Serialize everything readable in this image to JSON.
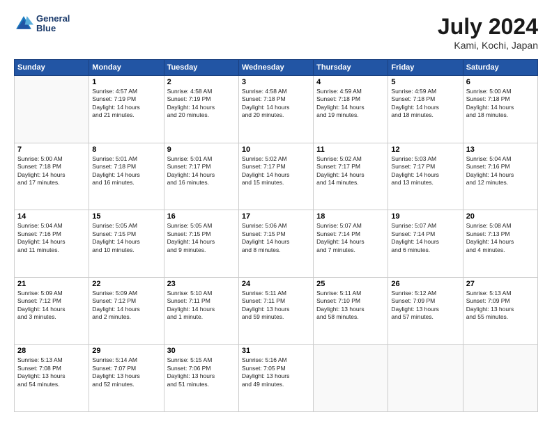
{
  "header": {
    "logo": {
      "line1": "General",
      "line2": "Blue"
    },
    "title": "July 2024",
    "location": "Kami, Kochi, Japan"
  },
  "weekdays": [
    "Sunday",
    "Monday",
    "Tuesday",
    "Wednesday",
    "Thursday",
    "Friday",
    "Saturday"
  ],
  "weeks": [
    [
      {
        "day": "",
        "info": ""
      },
      {
        "day": "1",
        "info": "Sunrise: 4:57 AM\nSunset: 7:19 PM\nDaylight: 14 hours\nand 21 minutes."
      },
      {
        "day": "2",
        "info": "Sunrise: 4:58 AM\nSunset: 7:19 PM\nDaylight: 14 hours\nand 20 minutes."
      },
      {
        "day": "3",
        "info": "Sunrise: 4:58 AM\nSunset: 7:18 PM\nDaylight: 14 hours\nand 20 minutes."
      },
      {
        "day": "4",
        "info": "Sunrise: 4:59 AM\nSunset: 7:18 PM\nDaylight: 14 hours\nand 19 minutes."
      },
      {
        "day": "5",
        "info": "Sunrise: 4:59 AM\nSunset: 7:18 PM\nDaylight: 14 hours\nand 18 minutes."
      },
      {
        "day": "6",
        "info": "Sunrise: 5:00 AM\nSunset: 7:18 PM\nDaylight: 14 hours\nand 18 minutes."
      }
    ],
    [
      {
        "day": "7",
        "info": "Sunrise: 5:00 AM\nSunset: 7:18 PM\nDaylight: 14 hours\nand 17 minutes."
      },
      {
        "day": "8",
        "info": "Sunrise: 5:01 AM\nSunset: 7:18 PM\nDaylight: 14 hours\nand 16 minutes."
      },
      {
        "day": "9",
        "info": "Sunrise: 5:01 AM\nSunset: 7:17 PM\nDaylight: 14 hours\nand 16 minutes."
      },
      {
        "day": "10",
        "info": "Sunrise: 5:02 AM\nSunset: 7:17 PM\nDaylight: 14 hours\nand 15 minutes."
      },
      {
        "day": "11",
        "info": "Sunrise: 5:02 AM\nSunset: 7:17 PM\nDaylight: 14 hours\nand 14 minutes."
      },
      {
        "day": "12",
        "info": "Sunrise: 5:03 AM\nSunset: 7:17 PM\nDaylight: 14 hours\nand 13 minutes."
      },
      {
        "day": "13",
        "info": "Sunrise: 5:04 AM\nSunset: 7:16 PM\nDaylight: 14 hours\nand 12 minutes."
      }
    ],
    [
      {
        "day": "14",
        "info": "Sunrise: 5:04 AM\nSunset: 7:16 PM\nDaylight: 14 hours\nand 11 minutes."
      },
      {
        "day": "15",
        "info": "Sunrise: 5:05 AM\nSunset: 7:15 PM\nDaylight: 14 hours\nand 10 minutes."
      },
      {
        "day": "16",
        "info": "Sunrise: 5:05 AM\nSunset: 7:15 PM\nDaylight: 14 hours\nand 9 minutes."
      },
      {
        "day": "17",
        "info": "Sunrise: 5:06 AM\nSunset: 7:15 PM\nDaylight: 14 hours\nand 8 minutes."
      },
      {
        "day": "18",
        "info": "Sunrise: 5:07 AM\nSunset: 7:14 PM\nDaylight: 14 hours\nand 7 minutes."
      },
      {
        "day": "19",
        "info": "Sunrise: 5:07 AM\nSunset: 7:14 PM\nDaylight: 14 hours\nand 6 minutes."
      },
      {
        "day": "20",
        "info": "Sunrise: 5:08 AM\nSunset: 7:13 PM\nDaylight: 14 hours\nand 4 minutes."
      }
    ],
    [
      {
        "day": "21",
        "info": "Sunrise: 5:09 AM\nSunset: 7:12 PM\nDaylight: 14 hours\nand 3 minutes."
      },
      {
        "day": "22",
        "info": "Sunrise: 5:09 AM\nSunset: 7:12 PM\nDaylight: 14 hours\nand 2 minutes."
      },
      {
        "day": "23",
        "info": "Sunrise: 5:10 AM\nSunset: 7:11 PM\nDaylight: 14 hours\nand 1 minute."
      },
      {
        "day": "24",
        "info": "Sunrise: 5:11 AM\nSunset: 7:11 PM\nDaylight: 13 hours\nand 59 minutes."
      },
      {
        "day": "25",
        "info": "Sunrise: 5:11 AM\nSunset: 7:10 PM\nDaylight: 13 hours\nand 58 minutes."
      },
      {
        "day": "26",
        "info": "Sunrise: 5:12 AM\nSunset: 7:09 PM\nDaylight: 13 hours\nand 57 minutes."
      },
      {
        "day": "27",
        "info": "Sunrise: 5:13 AM\nSunset: 7:09 PM\nDaylight: 13 hours\nand 55 minutes."
      }
    ],
    [
      {
        "day": "28",
        "info": "Sunrise: 5:13 AM\nSunset: 7:08 PM\nDaylight: 13 hours\nand 54 minutes."
      },
      {
        "day": "29",
        "info": "Sunrise: 5:14 AM\nSunset: 7:07 PM\nDaylight: 13 hours\nand 52 minutes."
      },
      {
        "day": "30",
        "info": "Sunrise: 5:15 AM\nSunset: 7:06 PM\nDaylight: 13 hours\nand 51 minutes."
      },
      {
        "day": "31",
        "info": "Sunrise: 5:16 AM\nSunset: 7:05 PM\nDaylight: 13 hours\nand 49 minutes."
      },
      {
        "day": "",
        "info": ""
      },
      {
        "day": "",
        "info": ""
      },
      {
        "day": "",
        "info": ""
      }
    ]
  ]
}
